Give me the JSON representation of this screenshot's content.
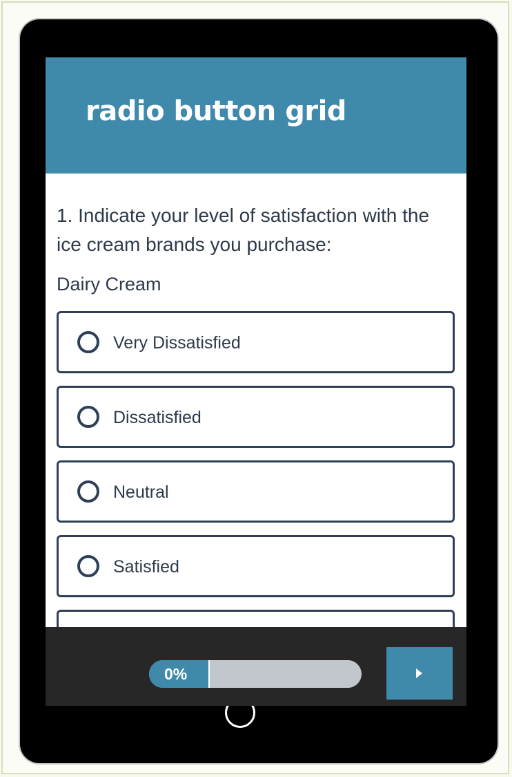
{
  "survey": {
    "title": "radio button grid",
    "question": "1. Indicate your level of satisfaction with the ice cream brands you purchase:",
    "row_label": "Dairy Cream",
    "options": [
      {
        "label": "Very Dissatisfied",
        "selected": false
      },
      {
        "label": "Dissatisfied",
        "selected": false
      },
      {
        "label": "Neutral",
        "selected": false
      },
      {
        "label": "Satisfied",
        "selected": false
      },
      {
        "label": "",
        "selected": false
      }
    ]
  },
  "footer": {
    "progress_text": "0%",
    "progress_value": 0,
    "next_icon": "play-arrow-icon"
  },
  "device": {
    "home_icon": "home-button-icon"
  },
  "colors": {
    "header": "#3f8aab",
    "text": "#2d3a4a",
    "border": "#2e3f58",
    "footer": "#272727",
    "progress_track": "#c2c7cd"
  }
}
